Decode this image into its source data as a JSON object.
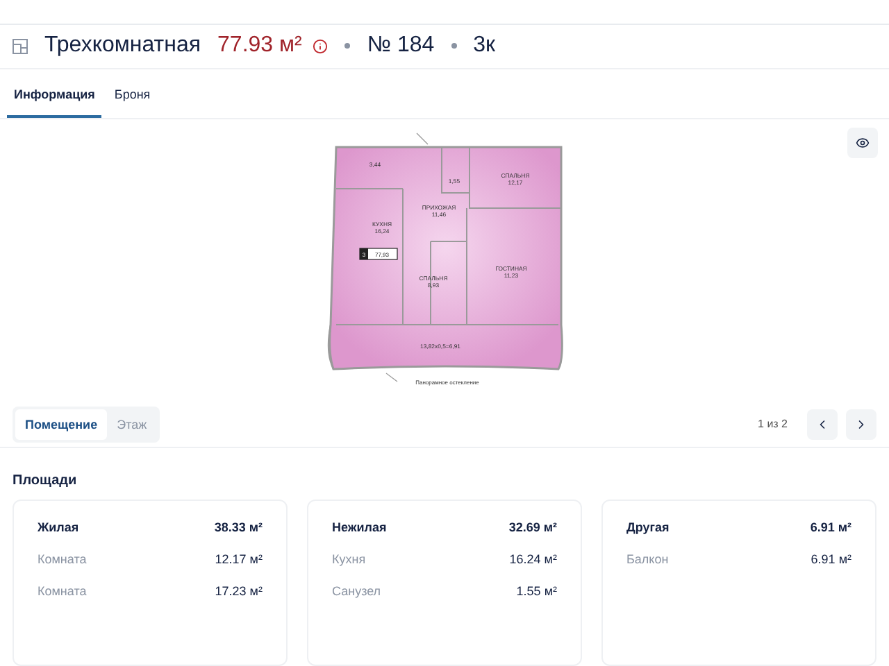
{
  "header": {
    "title": "Трехкомнатная",
    "area": "77.93 м²",
    "number": "№ 184",
    "rooms": "3к"
  },
  "tabs": [
    {
      "label": "Информация",
      "selected": true
    },
    {
      "label": "Броня",
      "selected": false
    }
  ],
  "plan": {
    "labels": [
      {
        "lines": [
          "3,44"
        ]
      },
      {
        "lines": [
          "1,55"
        ]
      },
      {
        "lines": [
          "СПАЛЬНЯ",
          "12,17"
        ]
      },
      {
        "lines": [
          "ПРИХОЖАЯ",
          "11,46"
        ]
      },
      {
        "lines": [
          "КУХНЯ",
          "16,24"
        ]
      },
      {
        "lines": [
          "СПАЛЬНЯ",
          "8,93"
        ]
      },
      {
        "lines": [
          "ГОСТИНАЯ",
          "11,23"
        ]
      },
      {
        "lines": [
          "13,82х0,5=6,91"
        ]
      },
      {
        "lines": [
          "Панорамное остекление"
        ]
      }
    ],
    "badge": {
      "rooms": "3",
      "area": "77,93"
    }
  },
  "view_switch": [
    {
      "label": "Помещение",
      "selected": true
    },
    {
      "label": "Этаж",
      "selected": false
    }
  ],
  "pager": "1 из 2",
  "areas_title": "Площади",
  "cards": [
    {
      "title": "Жилая",
      "total": "38.33 м²",
      "rows": [
        {
          "label": "Комната",
          "value": "12.17 м²"
        },
        {
          "label": "Комната",
          "value": "17.23 м²"
        }
      ]
    },
    {
      "title": "Нежилая",
      "total": "32.69 м²",
      "rows": [
        {
          "label": "Кухня",
          "value": "16.24 м²"
        },
        {
          "label": "Санузел",
          "value": "1.55 м²"
        }
      ]
    },
    {
      "title": "Другая",
      "total": "6.91 м²",
      "rows": [
        {
          "label": "Балкон",
          "value": "6.91 м²"
        }
      ]
    }
  ]
}
